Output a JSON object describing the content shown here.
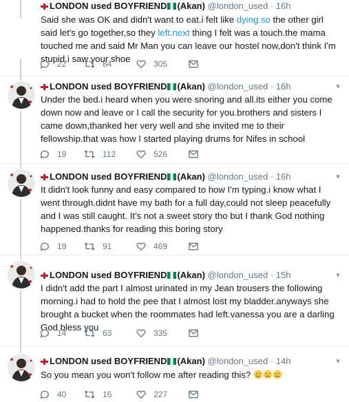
{
  "author": {
    "name": "LONDON used BOYFRIEND",
    "suffix": "(Akan)",
    "handle": "@london_used",
    "dot": "·"
  },
  "icons": {
    "reply": "reply-icon",
    "retweet": "retweet-icon",
    "like": "heart-icon",
    "dm": "envelope-icon",
    "caret": "chevron-down-icon",
    "flag1": "england-flag-emoji",
    "flag2": "nigeria-flag-emoji",
    "emoji": "sad-tear-face-emoji"
  },
  "colors": {
    "link": "#1b95e0",
    "meta": "#657786",
    "text": "#14171a",
    "divider": "#e6ecf0"
  },
  "tweets": [
    {
      "time": "16h",
      "segments": [
        {
          "t": "Said she was OK and didn't want to eat.i felt like "
        },
        {
          "t": "dying.so",
          "link": true
        },
        {
          "t": " the other girl said let's go together,so they "
        },
        {
          "t": "left.next",
          "link": true
        },
        {
          "t": " thing I felt was a touch.the mama touched me and said Mr Man  you can leave our hostel now,don't think I'm stupid.i saw your shoe"
        }
      ],
      "replies": "22",
      "retweets": "84",
      "likes": "305"
    },
    {
      "time": "16h",
      "text": "Under the bed.i heard when you were snoring and all.its either you come down now and leave or I call the security for you.brothers and sisters I came down,thanked her very well and she invited me to their fellowship.that was how I started playing drums for  Nifes in school",
      "replies": "19",
      "retweets": "112",
      "likes": "526"
    },
    {
      "time": "16h",
      "text": "It didn't look funny and easy compared to how I'm typing.i know what I went through.didnt have my bath for a full day,could not sleep peacefully and I was still caught. It's not a sweet story tho but I thank God nothing happened.thanks for reading this boring story",
      "replies": "19",
      "retweets": "91",
      "likes": "469"
    },
    {
      "time": "15h",
      "text": "I didn't add the part I almost urinated in my Jean trousers the following morning.i had to hold the pee that I almost lost my bladder.anyways she brought a bucket when the roommates had left.vanessa you are a darling God bless you",
      "replies": "14",
      "retweets": "63",
      "likes": "335"
    },
    {
      "time": "14h",
      "text": "So you mean you won't follow me after reading this?",
      "replies": "40",
      "retweets": "16",
      "likes": "227"
    }
  ]
}
